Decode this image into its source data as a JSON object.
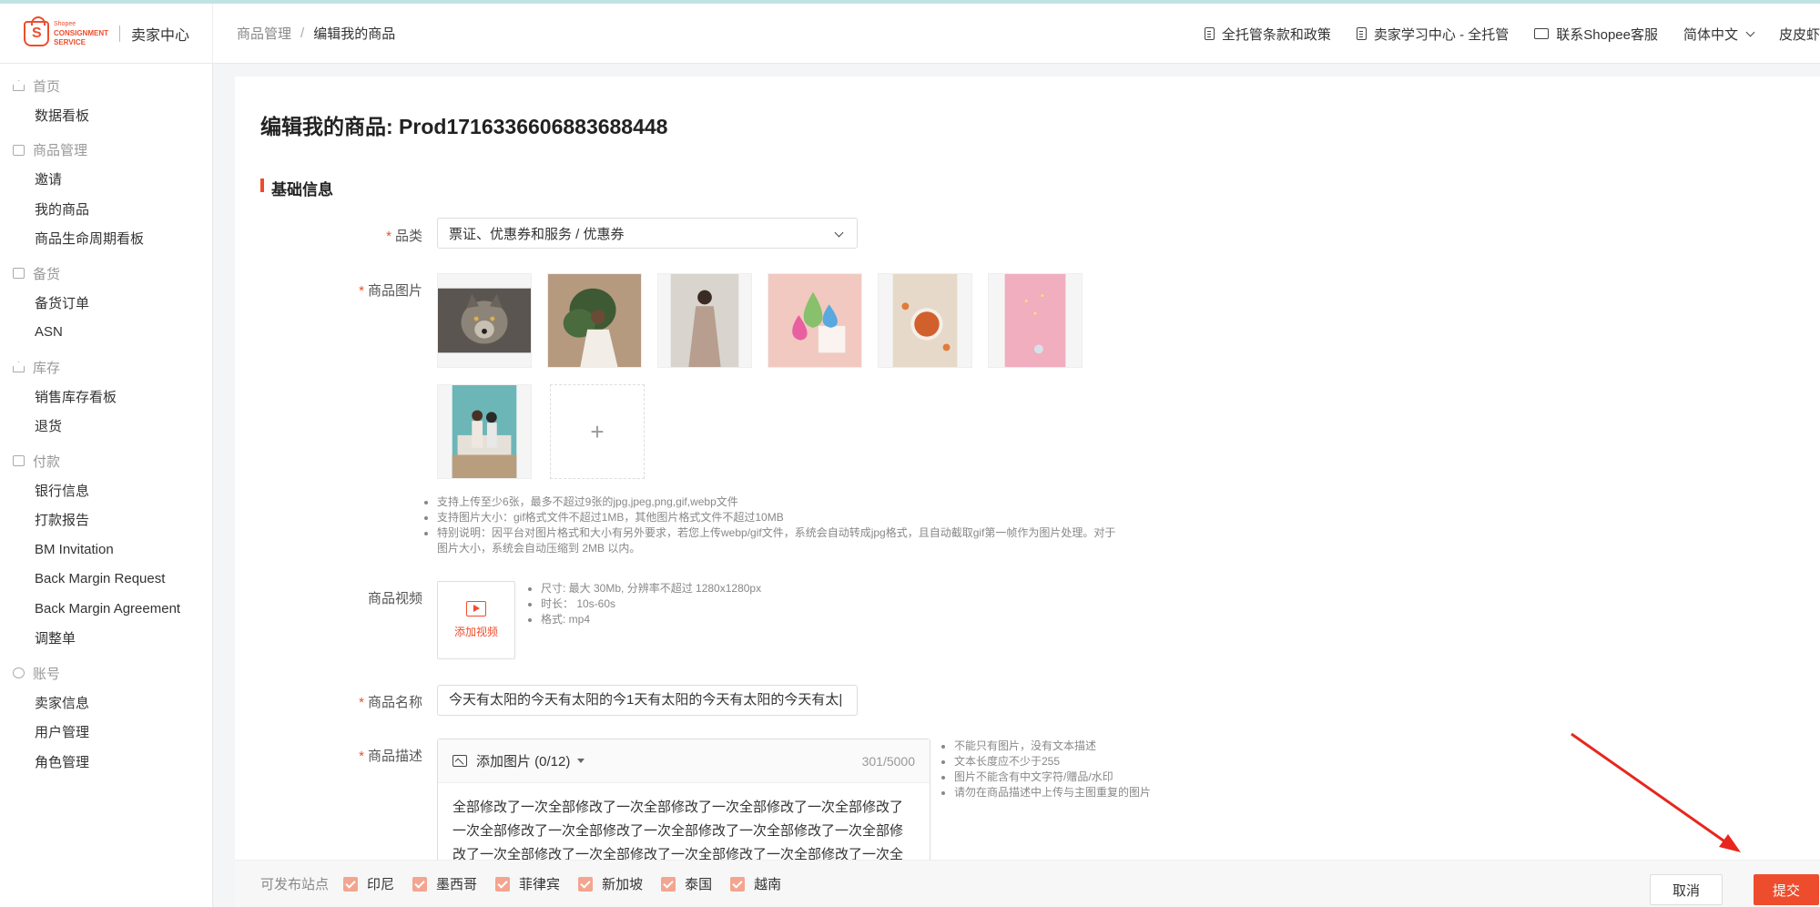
{
  "brand": {
    "logo_line1": "Shopee",
    "logo_line2": "CONSIGNMENT",
    "logo_line3": "SERVICE",
    "title": "卖家中心"
  },
  "breadcrumb": {
    "parent": "商品管理",
    "current": "编辑我的商品"
  },
  "top_links": {
    "terms": "全托管条款和政策",
    "learn": "卖家学习中心 - 全托管",
    "support": "联系Shopee客服",
    "language": "简体中文",
    "user": "皮皮虾"
  },
  "sidebar": {
    "groups": [
      {
        "label": "首页",
        "items": [
          "数据看板"
        ]
      },
      {
        "label": "商品管理",
        "items": [
          "邀请",
          "我的商品",
          "商品生命周期看板"
        ]
      },
      {
        "label": "备货",
        "items": [
          "备货订单",
          "ASN"
        ]
      },
      {
        "label": "库存",
        "items": [
          "销售库存看板",
          "退货"
        ]
      },
      {
        "label": "付款",
        "items": [
          "银行信息",
          "打款报告",
          "BM Invitation",
          "Back Margin Request",
          "Back Margin Agreement",
          "调整单"
        ]
      },
      {
        "label": "账号",
        "items": [
          "卖家信息",
          "用户管理",
          "角色管理"
        ]
      }
    ]
  },
  "page": {
    "title": "编辑我的商品: Prod1716336606883688448",
    "section": "基础信息"
  },
  "form": {
    "category_label": "品类",
    "category_value": "票证、优惠券和服务 / 优惠券",
    "images_label": "商品图片",
    "add_symbol": "+",
    "image_tips": [
      "支持上传至少6张，最多不超过9张的jpg,jpeg,png,gif,webp文件",
      "支持图片大小：gif格式文件不超过1MB，其他图片格式文件不超过10MB",
      "特别说明：因平台对图片格式和大小有另外要求，若您上传webp/gif文件，系统会自动转成jpg格式，且自动截取gif第一帧作为图片处理。对于图片大小，系统会自动压缩到 2MB 以内。"
    ],
    "video_label": "商品视频",
    "video_add": "添加视频",
    "video_tips": [
      "尺寸: 最大 30Mb, 分辨率不超过 1280x1280px",
      "时长： 10s-60s",
      "格式: mp4"
    ],
    "name_label": "商品名称",
    "name_value": "今天有太阳的今天有太阳的今1天有太阳的今天有太阳的今天有太|",
    "desc_label": "商品描述",
    "desc_add_image": "添加图片 (0/12)",
    "desc_counter": "301/5000",
    "desc_text": "全部修改了一次全部修改了一次全部修改了一次全部修改了一次全部修改了一次全部修改了一次全部修改了一次全部修改了一次全部修改了一次全部修改了一次全部修改了一次全部修改了一次全部修改了一次全部修改了一次全部修改了一次全",
    "desc_tips": [
      "不能只有图片，没有文本描述",
      "文本长度应不少于255",
      "图片不能含有中文字符/赠品/水印",
      "请勿在商品描述中上传与主图重复的图片"
    ]
  },
  "footer": {
    "sites_label": "可发布站点",
    "sites": [
      "印尼",
      "墨西哥",
      "菲律宾",
      "新加坡",
      "泰国",
      "越南"
    ],
    "cancel": "取消",
    "submit": "提交"
  },
  "colors": {
    "accent": "#ee4d2d",
    "checkbox": "#f4a58f",
    "annotation_arrow": "#e8261e"
  },
  "icons": {
    "images": [
      "wolf-photo",
      "woman-with-monstera-photo",
      "woman-in-dress-photo",
      "makeup-sponges-photo",
      "food-bowl-photo",
      "pink-background-photo",
      "couple-on-car-photo"
    ]
  }
}
